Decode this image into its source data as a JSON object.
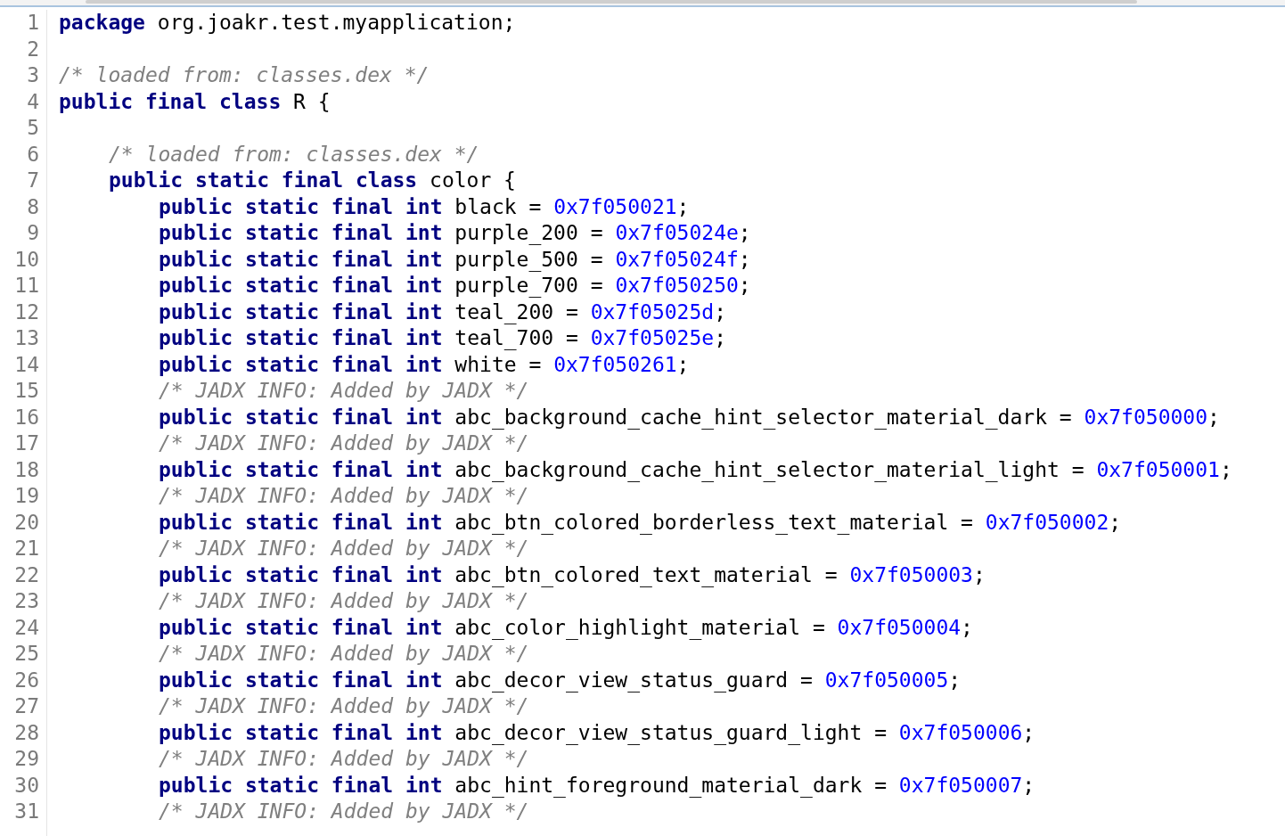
{
  "editor": {
    "lines": [
      {
        "number": "1",
        "tokens": [
          {
            "kind": "keyword",
            "text": "package"
          },
          {
            "kind": "plain",
            "text": " org.joakr.test.myapplication;"
          }
        ]
      },
      {
        "number": "2"
      },
      {
        "number": "3",
        "tokens": [
          {
            "kind": "comment",
            "text": "/* loaded from: classes.dex */"
          }
        ]
      },
      {
        "number": "4",
        "tokens": [
          {
            "kind": "keyword",
            "text": "public final class"
          },
          {
            "kind": "plain",
            "text": " R {"
          }
        ],
        "children": [
          {
            "number": "5"
          },
          {
            "number": "6",
            "tokens": [
              {
                "kind": "comment",
                "text": "/* loaded from: classes.dex */"
              }
            ]
          },
          {
            "number": "7",
            "tokens": [
              {
                "kind": "keyword",
                "text": "public static final class"
              },
              {
                "kind": "plain",
                "text": " color {"
              }
            ],
            "children": [
              {
                "number": "8",
                "tokens": [
                  {
                    "kind": "keyword",
                    "text": "public static final int"
                  },
                  {
                    "kind": "plain",
                    "text": " black = "
                  },
                  {
                    "kind": "number",
                    "text": "0x7f050021"
                  },
                  {
                    "kind": "plain",
                    "text": ";"
                  }
                ]
              },
              {
                "number": "9",
                "tokens": [
                  {
                    "kind": "keyword",
                    "text": "public static final int"
                  },
                  {
                    "kind": "plain",
                    "text": " purple_200 = "
                  },
                  {
                    "kind": "number",
                    "text": "0x7f05024e"
                  },
                  {
                    "kind": "plain",
                    "text": ";"
                  }
                ]
              },
              {
                "number": "10",
                "tokens": [
                  {
                    "kind": "keyword",
                    "text": "public static final int"
                  },
                  {
                    "kind": "plain",
                    "text": " purple_500 = "
                  },
                  {
                    "kind": "number",
                    "text": "0x7f05024f"
                  },
                  {
                    "kind": "plain",
                    "text": ";"
                  }
                ]
              },
              {
                "number": "11",
                "tokens": [
                  {
                    "kind": "keyword",
                    "text": "public static final int"
                  },
                  {
                    "kind": "plain",
                    "text": " purple_700 = "
                  },
                  {
                    "kind": "number",
                    "text": "0x7f050250"
                  },
                  {
                    "kind": "plain",
                    "text": ";"
                  }
                ]
              },
              {
                "number": "12",
                "tokens": [
                  {
                    "kind": "keyword",
                    "text": "public static final int"
                  },
                  {
                    "kind": "plain",
                    "text": " teal_200 = "
                  },
                  {
                    "kind": "number",
                    "text": "0x7f05025d"
                  },
                  {
                    "kind": "plain",
                    "text": ";"
                  }
                ]
              },
              {
                "number": "13",
                "tokens": [
                  {
                    "kind": "keyword",
                    "text": "public static final int"
                  },
                  {
                    "kind": "plain",
                    "text": " teal_700 = "
                  },
                  {
                    "kind": "number",
                    "text": "0x7f05025e"
                  },
                  {
                    "kind": "plain",
                    "text": ";"
                  }
                ]
              },
              {
                "number": "14",
                "tokens": [
                  {
                    "kind": "keyword",
                    "text": "public static final int"
                  },
                  {
                    "kind": "plain",
                    "text": " white = "
                  },
                  {
                    "kind": "number",
                    "text": "0x7f050261"
                  },
                  {
                    "kind": "plain",
                    "text": ";"
                  }
                ]
              },
              {
                "number": "15",
                "tokens": [
                  {
                    "kind": "comment",
                    "text": "/* JADX INFO: Added by JADX */"
                  }
                ]
              },
              {
                "number": "16",
                "tokens": [
                  {
                    "kind": "keyword",
                    "text": "public static final int"
                  },
                  {
                    "kind": "plain",
                    "text": " abc_background_cache_hint_selector_material_dark = "
                  },
                  {
                    "kind": "number",
                    "text": "0x7f050000"
                  },
                  {
                    "kind": "plain",
                    "text": ";"
                  }
                ]
              },
              {
                "number": "17",
                "tokens": [
                  {
                    "kind": "comment",
                    "text": "/* JADX INFO: Added by JADX */"
                  }
                ]
              },
              {
                "number": "18",
                "tokens": [
                  {
                    "kind": "keyword",
                    "text": "public static final int"
                  },
                  {
                    "kind": "plain",
                    "text": " abc_background_cache_hint_selector_material_light = "
                  },
                  {
                    "kind": "number",
                    "text": "0x7f050001"
                  },
                  {
                    "kind": "plain",
                    "text": ";"
                  }
                ]
              },
              {
                "number": "19",
                "tokens": [
                  {
                    "kind": "comment",
                    "text": "/* JADX INFO: Added by JADX */"
                  }
                ]
              },
              {
                "number": "20",
                "tokens": [
                  {
                    "kind": "keyword",
                    "text": "public static final int"
                  },
                  {
                    "kind": "plain",
                    "text": " abc_btn_colored_borderless_text_material = "
                  },
                  {
                    "kind": "number",
                    "text": "0x7f050002"
                  },
                  {
                    "kind": "plain",
                    "text": ";"
                  }
                ]
              },
              {
                "number": "21",
                "tokens": [
                  {
                    "kind": "comment",
                    "text": "/* JADX INFO: Added by JADX */"
                  }
                ]
              },
              {
                "number": "22",
                "tokens": [
                  {
                    "kind": "keyword",
                    "text": "public static final int"
                  },
                  {
                    "kind": "plain",
                    "text": " abc_btn_colored_text_material = "
                  },
                  {
                    "kind": "number",
                    "text": "0x7f050003"
                  },
                  {
                    "kind": "plain",
                    "text": ";"
                  }
                ]
              },
              {
                "number": "23",
                "tokens": [
                  {
                    "kind": "comment",
                    "text": "/* JADX INFO: Added by JADX */"
                  }
                ]
              },
              {
                "number": "24",
                "tokens": [
                  {
                    "kind": "keyword",
                    "text": "public static final int"
                  },
                  {
                    "kind": "plain",
                    "text": " abc_color_highlight_material = "
                  },
                  {
                    "kind": "number",
                    "text": "0x7f050004"
                  },
                  {
                    "kind": "plain",
                    "text": ";"
                  }
                ]
              },
              {
                "number": "25",
                "tokens": [
                  {
                    "kind": "comment",
                    "text": "/* JADX INFO: Added by JADX */"
                  }
                ]
              },
              {
                "number": "26",
                "tokens": [
                  {
                    "kind": "keyword",
                    "text": "public static final int"
                  },
                  {
                    "kind": "plain",
                    "text": " abc_decor_view_status_guard = "
                  },
                  {
                    "kind": "number",
                    "text": "0x7f050005"
                  },
                  {
                    "kind": "plain",
                    "text": ";"
                  }
                ]
              },
              {
                "number": "27",
                "tokens": [
                  {
                    "kind": "comment",
                    "text": "/* JADX INFO: Added by JADX */"
                  }
                ]
              },
              {
                "number": "28",
                "tokens": [
                  {
                    "kind": "keyword",
                    "text": "public static final int"
                  },
                  {
                    "kind": "plain",
                    "text": " abc_decor_view_status_guard_light = "
                  },
                  {
                    "kind": "number",
                    "text": "0x7f050006"
                  },
                  {
                    "kind": "plain",
                    "text": ";"
                  }
                ]
              },
              {
                "number": "29",
                "tokens": [
                  {
                    "kind": "comment",
                    "text": "/* JADX INFO: Added by JADX */"
                  }
                ]
              },
              {
                "number": "30",
                "tokens": [
                  {
                    "kind": "keyword",
                    "text": "public static final int"
                  },
                  {
                    "kind": "plain",
                    "text": " abc_hint_foreground_material_dark = "
                  },
                  {
                    "kind": "number",
                    "text": "0x7f050007"
                  },
                  {
                    "kind": "plain",
                    "text": ";"
                  }
                ]
              },
              {
                "number": "31",
                "tokens": [
                  {
                    "kind": "comment",
                    "text": "/* JADX INFO: Added by JADX */"
                  }
                ]
              }
            ]
          }
        ]
      }
    ]
  }
}
